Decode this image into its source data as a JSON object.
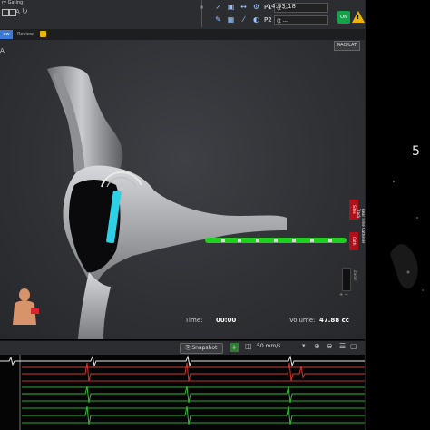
{
  "toolbar": {
    "gating_label": "ry Gating",
    "icons": [
      "camera-icon",
      "display-icon",
      "auto-icon",
      "refresh-icon"
    ],
    "p1_label": "P1",
    "p1_value": "(t ---",
    "p2_label": "P2",
    "p2_value": "(t ---",
    "clock": "14:53:18",
    "on_badge": "ON",
    "warning": "!"
  },
  "tabs": [
    {
      "label": "ew",
      "active": true
    },
    {
      "label": "Review",
      "active": false
    }
  ],
  "viewport": {
    "chamber_tag": "A",
    "projection_button": "RAO/LAT",
    "time_label": "Time:",
    "time_value": "00:00",
    "volume_label": "Volume:",
    "volume_value": "47.88 cc"
  },
  "side_tabs": {
    "top": "Sites",
    "bottom": "Cath",
    "vertical_title": "Real Time Catheter Track",
    "zoom_label": "Zoom"
  },
  "right_panel": {
    "marker": "5"
  },
  "ecg_bar": {
    "snapshot_label": "Snapshot",
    "sweep_speed": "50 mm/s"
  },
  "colors": {
    "accent_green": "#1fd11f",
    "alert_red": "#b0101a",
    "catheter_cyan": "#2fd0e6"
  }
}
